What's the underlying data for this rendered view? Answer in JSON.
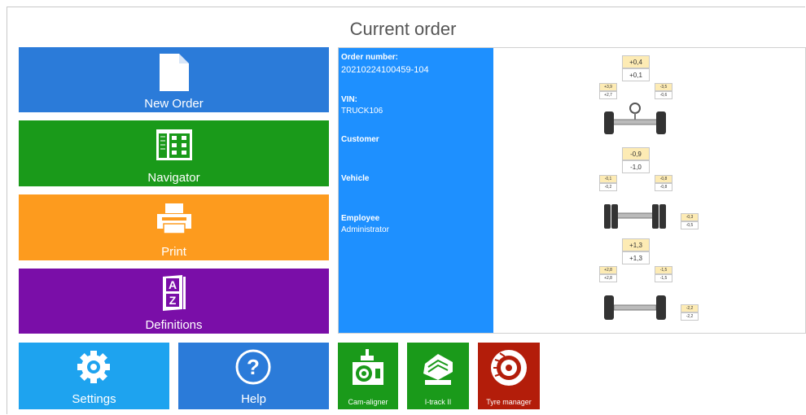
{
  "title": "Current order",
  "tiles": {
    "new_order": "New Order",
    "navigator": "Navigator",
    "print": "Print",
    "definitions": "Definitions",
    "settings": "Settings",
    "help": "Help",
    "cam_aligner": "Cam-aligner",
    "itrack": "I-track II",
    "tyre_manager": "Tyre manager"
  },
  "order": {
    "order_number_label": "Order number:",
    "order_number": "20210224100459-104",
    "vin_label": "VIN:",
    "vin": "TRUCK106",
    "customer_label": "Customer",
    "vehicle_label": "Vehicle",
    "employee_label": "Employee",
    "employee": "Administrator"
  },
  "alignment": {
    "axle1": {
      "total_top": "+0,4",
      "total_bottom": "+0,1",
      "left_top": "+3,9",
      "left_bottom": "+2,7",
      "right_top": "-3,5",
      "right_bottom": "-0,6"
    },
    "axle2": {
      "total_top": "-0,9",
      "total_bottom": "-1,0",
      "left_top": "-0,1",
      "left_bottom": "-0,2",
      "right_top": "-0,8",
      "right_bottom": "-0,8",
      "side_top": "-0,3",
      "side_bottom": "-0,5"
    },
    "axle3": {
      "total_top": "+1,3",
      "total_bottom": "+1,3",
      "left_top": "+2,8",
      "left_bottom": "+2,8",
      "right_top": "-1,5",
      "right_bottom": "-1,5",
      "side_top": "-2,2",
      "side_bottom": "-2,2"
    }
  },
  "colors": {
    "blue": "#2b7bd9",
    "green": "#1a9a1a",
    "orange": "#fd9b1e",
    "purple": "#7a0ea8",
    "light_blue": "#1ea3ef",
    "red": "#b31d0a",
    "info_blue": "#1e90ff"
  }
}
